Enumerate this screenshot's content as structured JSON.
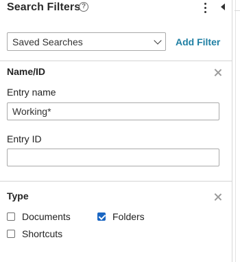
{
  "header": {
    "title": "Search Filters",
    "help_icon": "?",
    "menu_icon": "kebab-menu-icon",
    "collapse_icon": "collapse-left-icon"
  },
  "saved_searches": {
    "selected": "Saved Searches",
    "add_filter_label": "Add Filter"
  },
  "name_section": {
    "title": "Name/ID",
    "entry_name_label": "Entry name",
    "entry_name_value": "Working*",
    "entry_id_label": "Entry ID",
    "entry_id_value": ""
  },
  "type_section": {
    "title": "Type",
    "options": [
      {
        "label": "Documents",
        "checked": false
      },
      {
        "label": "Folders",
        "checked": true
      },
      {
        "label": "Shortcuts",
        "checked": false
      }
    ]
  },
  "colors": {
    "accent": "#1f7fa3",
    "checkbox_checked": "#1a66c2"
  }
}
